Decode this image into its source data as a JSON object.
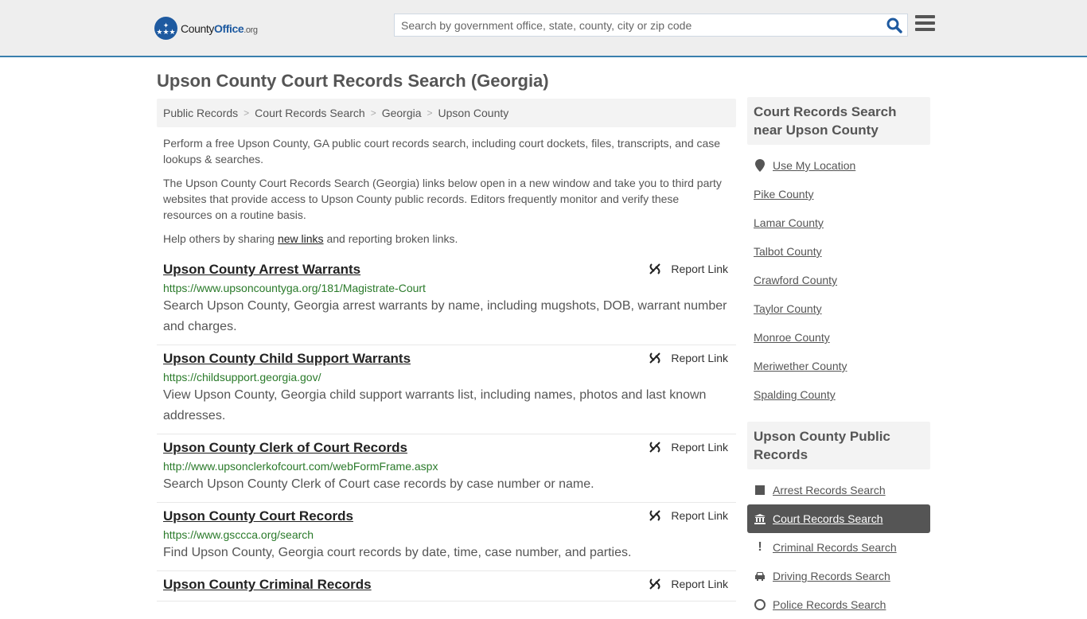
{
  "header": {
    "logo": {
      "prefix": "County",
      "brand": "Office",
      "suffix": ".org"
    },
    "search_placeholder": "Search by government office, state, county, city or zip code",
    "search_value": ""
  },
  "page_title": "Upson County Court Records Search (Georgia)",
  "breadcrumb": [
    "Public Records",
    "Court Records Search",
    "Georgia",
    "Upson County"
  ],
  "intro": {
    "p1": "Perform a free Upson County, GA public court records search, including court dockets, files, transcripts, and case lookups & searches.",
    "p2": "The Upson County Court Records Search (Georgia) links below open in a new window and take you to third party websites that provide access to Upson County public records. Editors frequently monitor and verify these resources on a routine basis.",
    "p3_before": "Help others by sharing ",
    "p3_link": "new links",
    "p3_after": " and reporting broken links."
  },
  "report_label": "Report Link",
  "results": [
    {
      "title": "Upson County Arrest Warrants",
      "url": "https://www.upsoncountyga.org/181/Magistrate-Court",
      "desc": "Search Upson County, Georgia arrest warrants by name, including mugshots, DOB, warrant number and charges."
    },
    {
      "title": "Upson County Child Support Warrants",
      "url": "https://childsupport.georgia.gov/",
      "desc": "View Upson County, Georgia child support warrants list, including names, photos and last known addresses."
    },
    {
      "title": "Upson County Clerk of Court Records",
      "url": "http://www.upsonclerkofcourt.com/webFormFrame.aspx",
      "desc": "Search Upson County Clerk of Court case records by case number or name."
    },
    {
      "title": "Upson County Court Records",
      "url": "https://www.gsccca.org/search",
      "desc": "Find Upson County, Georgia court records by date, time, case number, and parties."
    },
    {
      "title": "Upson County Criminal Records",
      "url": "",
      "desc": ""
    }
  ],
  "sidebar": {
    "nearby_title": "Court Records Search near Upson County",
    "use_location": "Use My Location",
    "nearby": [
      "Pike County",
      "Lamar County",
      "Talbot County",
      "Crawford County",
      "Taylor County",
      "Monroe County",
      "Meriwether County",
      "Spalding County"
    ],
    "public_title": "Upson County Public Records",
    "public_records": [
      {
        "label": "Arrest Records Search",
        "icon": "square-icon",
        "active": false
      },
      {
        "label": "Court Records Search",
        "icon": "courthouse-icon",
        "active": true
      },
      {
        "label": "Criminal Records Search",
        "icon": "exclamation-icon",
        "active": false
      },
      {
        "label": "Driving Records Search",
        "icon": "car-icon",
        "active": false
      },
      {
        "label": "Police Records Search",
        "icon": "police-icon",
        "active": false
      }
    ]
  },
  "colors": {
    "brand": "#1e5aa0",
    "accent_border": "#3a7fad",
    "url_green": "#2a7a2a",
    "active_bg": "#555555"
  }
}
